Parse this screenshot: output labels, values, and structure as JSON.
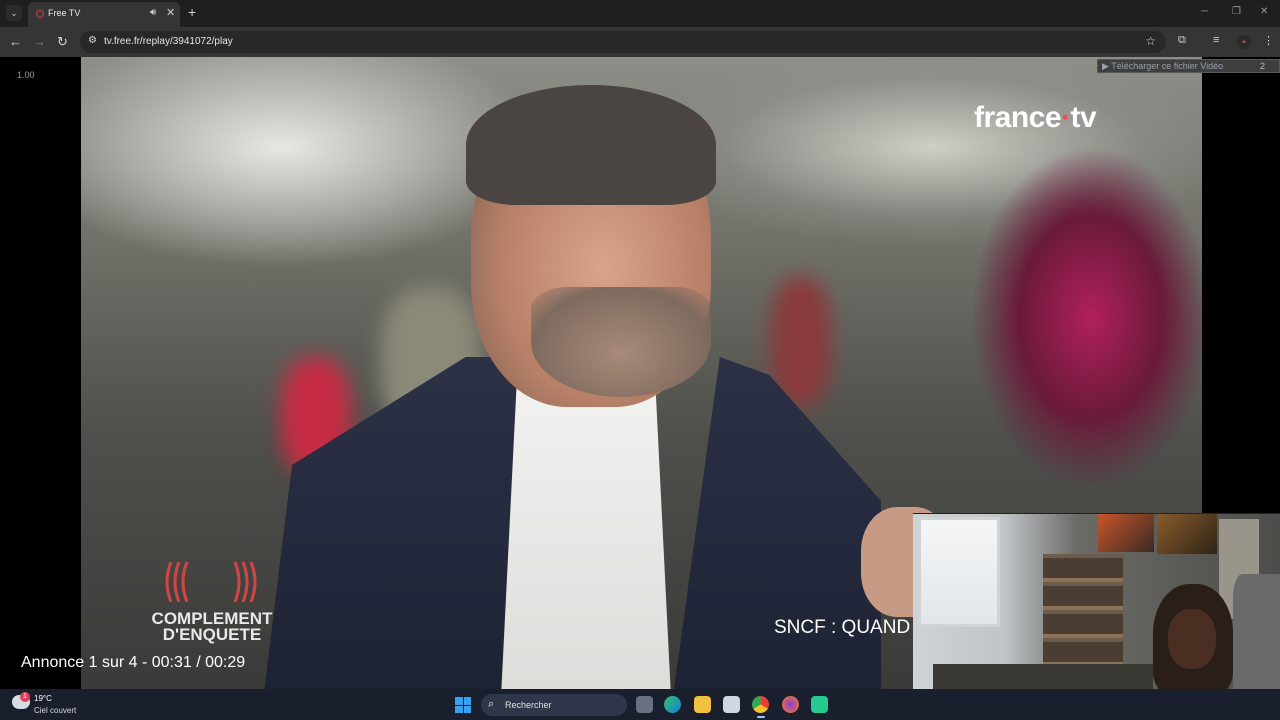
{
  "browser": {
    "tab_menu_icon": "chevron-down-icon",
    "tab_title": "Free TV",
    "tab_audio_icon": "speaker-icon",
    "new_tab_icon": "plus-icon",
    "url": "tv.free.fr/replay/3941072/play",
    "accent_color": "#d43b3b"
  },
  "page": {
    "playback_speed": "1.00",
    "download_banner": "▶ Télécharger ce fichier Vidéo",
    "download_badge": "2",
    "ad_counter": "Annonce 1 sur 4 - 00:31 / 00:29"
  },
  "video": {
    "channel_logo_main": "france",
    "channel_logo_dot": "·",
    "channel_logo_tv": "tv",
    "program_line1": "COMPLEMENT",
    "program_line2": "D'ENQUETE",
    "subtitle": "SNCF : QUAND"
  },
  "taskbar": {
    "temperature": "19°C",
    "weather": "Ciel couvert",
    "weather_badge": "1",
    "search_placeholder": "Rechercher"
  }
}
